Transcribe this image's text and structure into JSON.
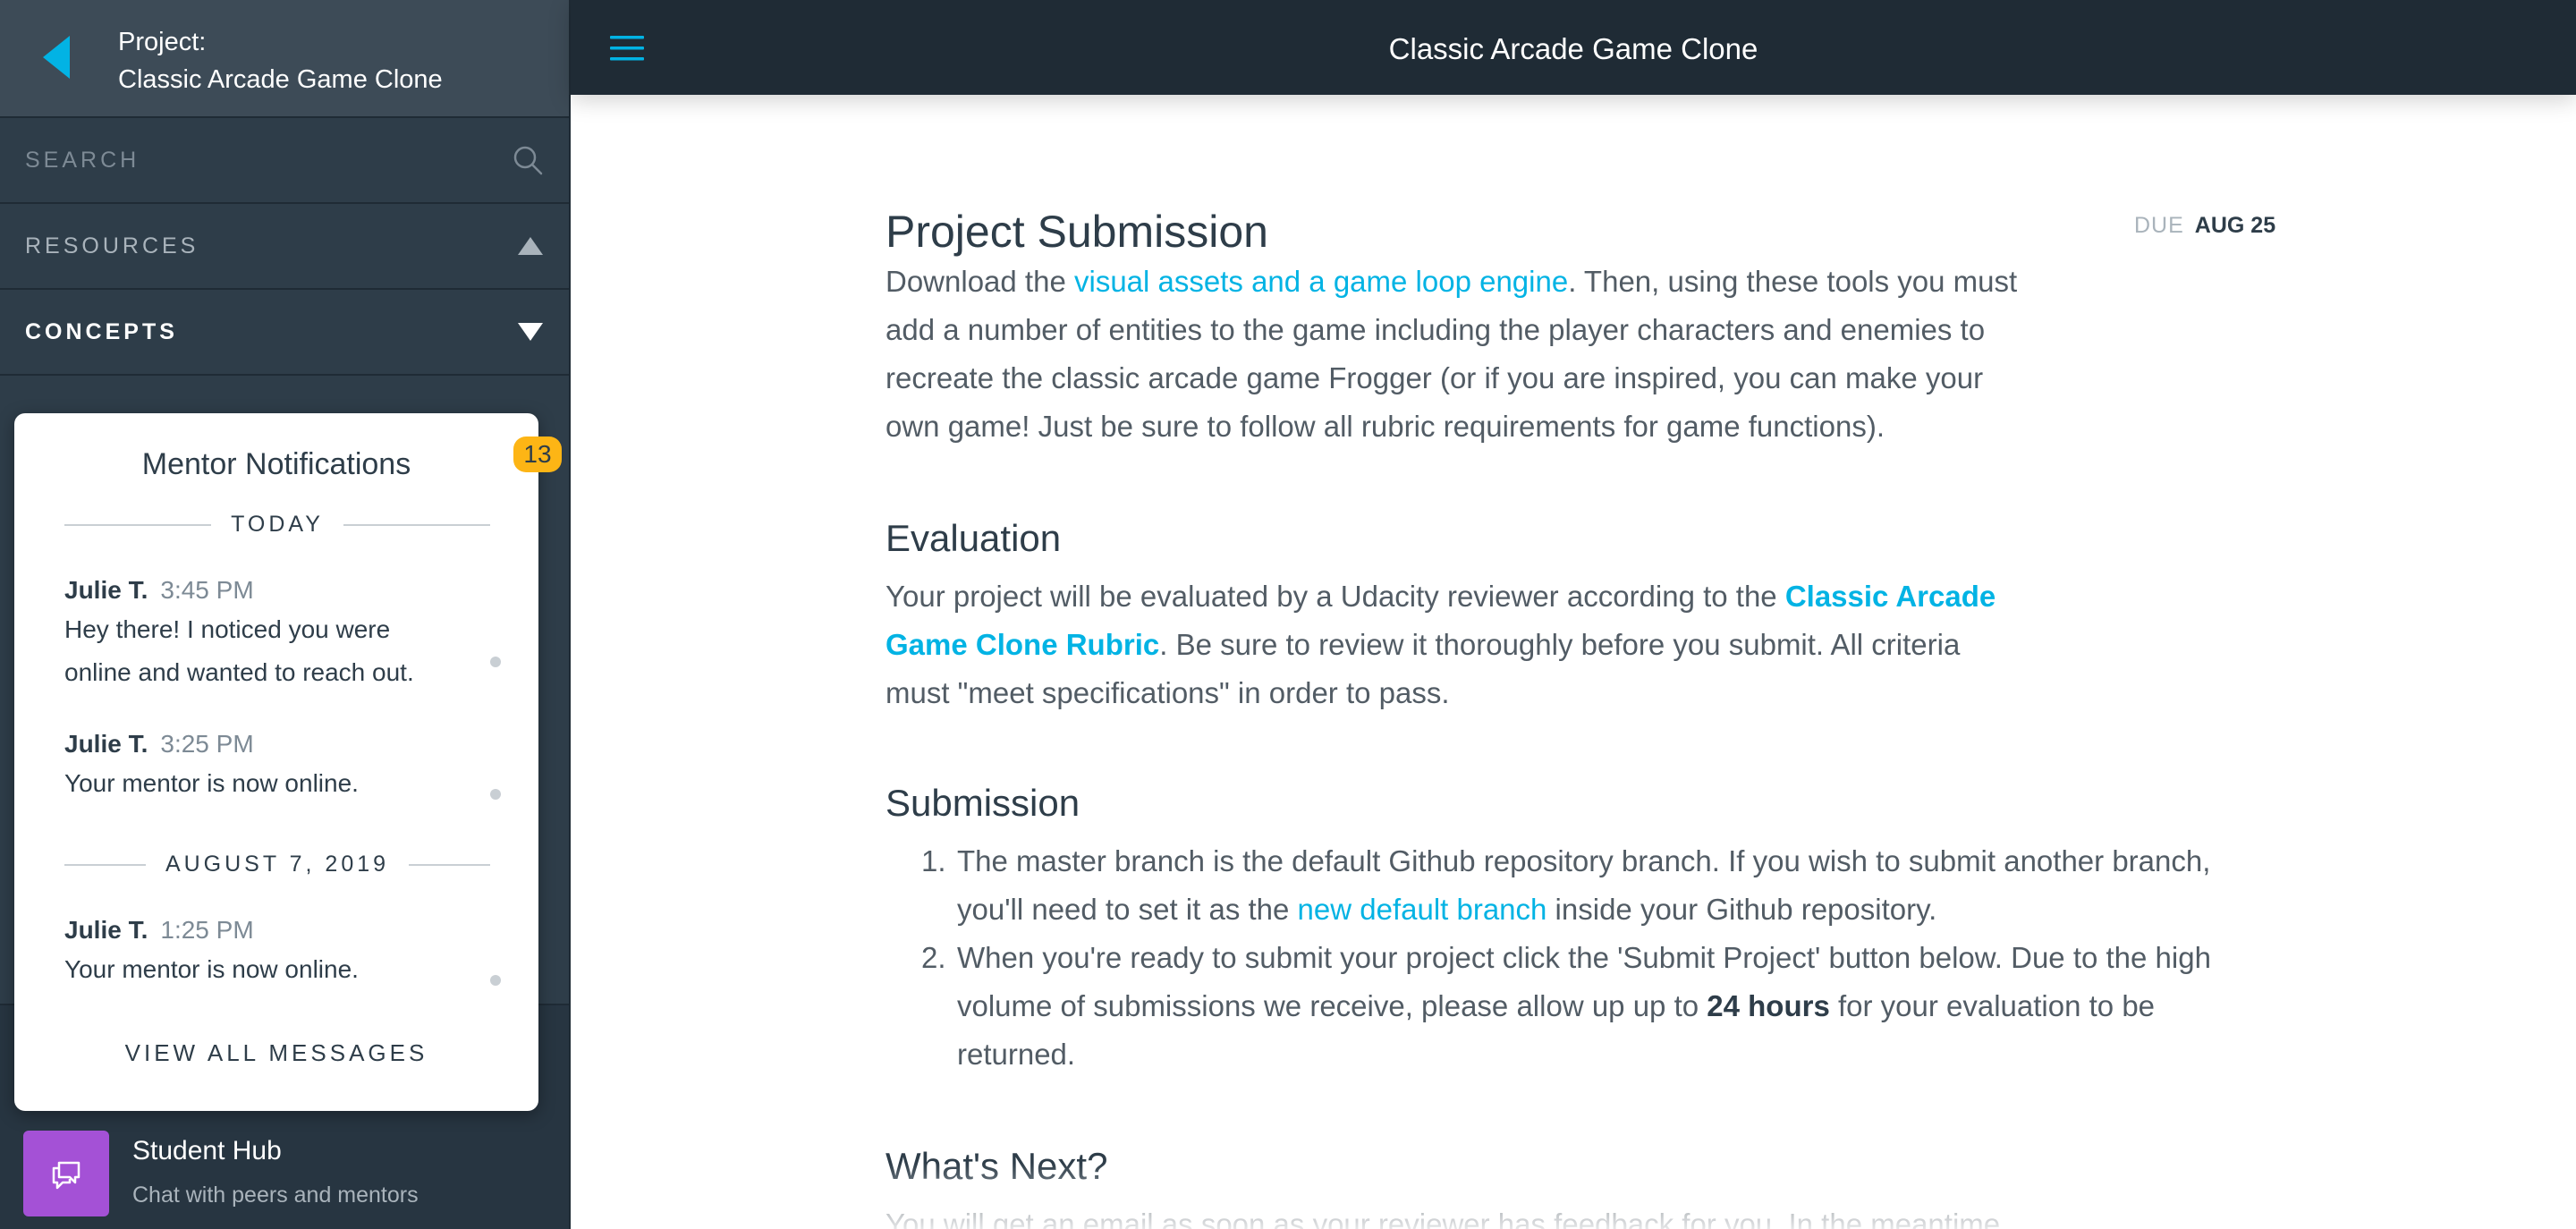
{
  "sidebar": {
    "project_prefix": "Project:",
    "project_name": "Classic Arcade Game Clone",
    "search_placeholder": "SEARCH",
    "resources_label": "RESOURCES",
    "concepts_label": "CONCEPTS",
    "icons": {
      "back": "back-triangle-icon",
      "search": "search-icon",
      "resources": "caret-up-icon",
      "concepts": "caret-down-icon"
    }
  },
  "notifications": {
    "title": "Mentor Notifications",
    "badge_count": "13",
    "groups": [
      {
        "date": "TODAY",
        "messages": [
          {
            "sender": "Julie T.",
            "time": "3:45 PM",
            "lines": [
              "Hey there! I noticed you were",
              "online and wanted to reach out."
            ]
          },
          {
            "sender": "Julie T.",
            "time": "3:25 PM",
            "lines": [
              "Your mentor is now online."
            ]
          }
        ]
      },
      {
        "date": "AUGUST 7, 2019",
        "messages": [
          {
            "sender": "Julie T.",
            "time": "1:25 PM",
            "lines": [
              "Your mentor is now online."
            ]
          }
        ]
      }
    ],
    "view_all_label": "VIEW ALL MESSAGES"
  },
  "student_hub": {
    "title": "Student Hub",
    "subtitle": "Chat with peers and mentors",
    "icon": "chat-bubbles-icon"
  },
  "topbar": {
    "title": "Classic Arcade Game Clone",
    "menu_icon": "hamburger-menu-icon"
  },
  "main": {
    "project_heading": "Project Submission",
    "due_label": "DUE",
    "due_date": "AUG 25",
    "intro": {
      "before": "Download the ",
      "link": "visual assets and a game loop engine",
      "line1_after": ". Then, using these tools you must",
      "line2": "add a number of entities to the game including the player characters and enemies to",
      "line3": "recreate the classic arcade game Frogger (or if you are inspired, you can make your",
      "line4": "own game! Just be sure to follow all rubric requirements for game functions)."
    },
    "evaluation": {
      "heading": "Evaluation",
      "line1_before": "Your project will be evaluated by a Udacity reviewer according to the ",
      "link_part1": "Classic Arcade",
      "link_part2": "Game Clone Rubric",
      "line2_after": ". Be sure to review it thoroughly before you submit. All criteria",
      "line3": "must \"meet specifications\" in order to pass."
    },
    "submission": {
      "heading": "Submission",
      "items": [
        {
          "number": "1.",
          "line1": "The master branch is the default Github repository branch. If you wish to submit another branch,",
          "line2_before": "you'll need to set it as the ",
          "link": "new default branch",
          "line2_after": " inside your Github repository."
        },
        {
          "number": "2.",
          "line1": "When you're ready to submit your project click the 'Submit Project' button below. Due to the high",
          "line2_before": "volume of submissions we receive, please allow up up to ",
          "bold": "24 hours",
          "line2_after": " for your evaluation to be",
          "line3": "returned."
        }
      ]
    },
    "whats_next": {
      "heading": "What's Next?",
      "line1": "You will get an email as soon as your reviewer has feedback for you. In the meantime,"
    }
  },
  "colors": {
    "sidebar_bg": "#2e3d49",
    "topbar_bg": "#1f2b35",
    "accent": "#02b3e4",
    "badge": "#fdb515",
    "hub_purple": "#a451d6"
  }
}
